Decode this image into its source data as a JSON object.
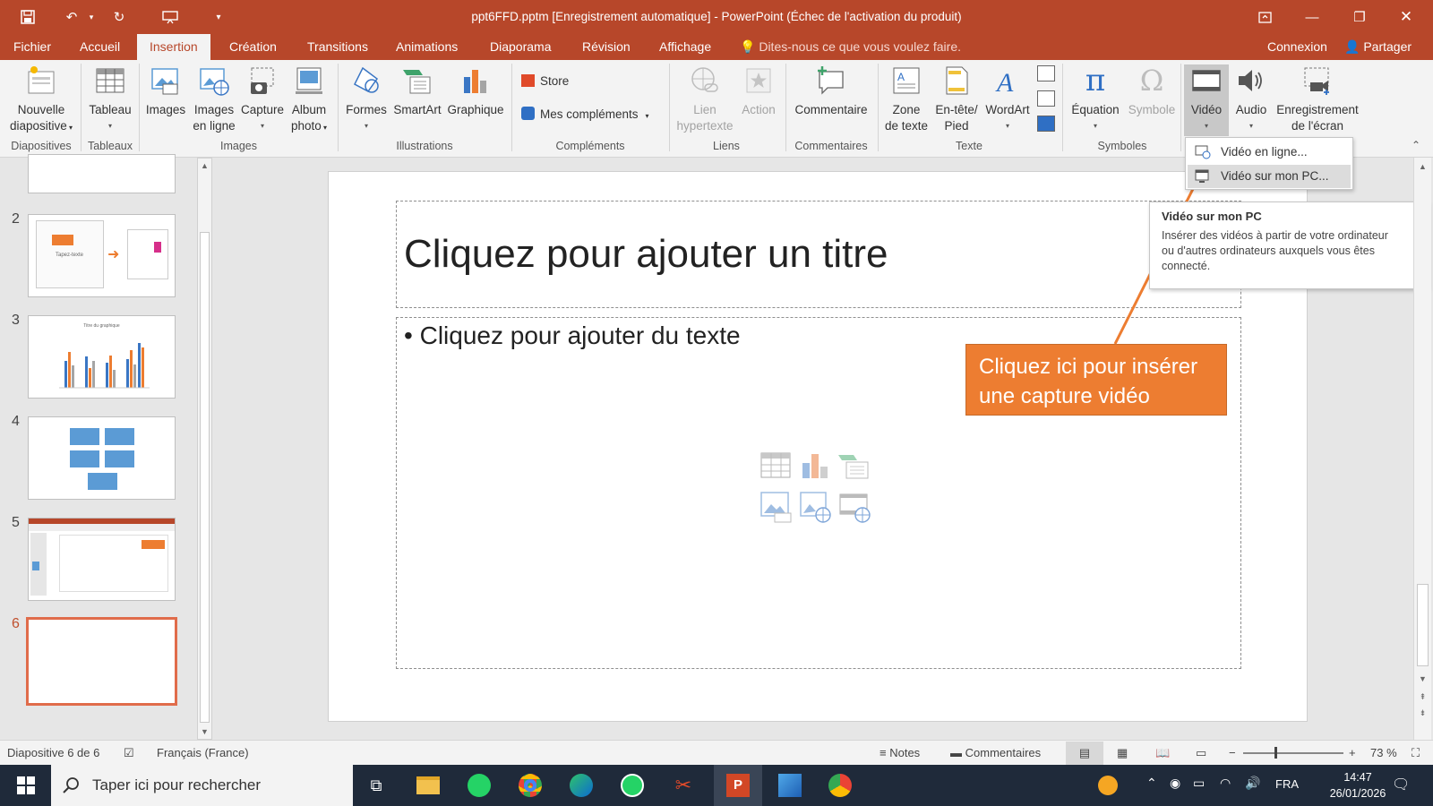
{
  "titlebar": {
    "title": "ppt6FFD.pptm [Enregistrement automatique]  -  PowerPoint (Échec de l'activation du produit)"
  },
  "menu": {
    "tabs": [
      "Fichier",
      "Accueil",
      "Insertion",
      "Création",
      "Transitions",
      "Animations",
      "Diaporama",
      "Révision",
      "Affichage"
    ],
    "active_tab": "Insertion",
    "tell_me": "Dites-nous ce que vous voulez faire.",
    "connexion": "Connexion",
    "partager": "Partager"
  },
  "ribbon": {
    "nouvelle_diapositive": [
      "Nouvelle",
      "diapositive"
    ],
    "tableau": "Tableau",
    "images": "Images",
    "images_en_ligne": [
      "Images",
      "en ligne"
    ],
    "capture": "Capture",
    "album_photo": [
      "Album",
      "photo"
    ],
    "formes": "Formes",
    "smartart": "SmartArt",
    "graphique": "Graphique",
    "store": "Store",
    "mes_complements": "Mes compléments",
    "lien_hypertexte": [
      "Lien",
      "hypertexte"
    ],
    "action": "Action",
    "commentaire": "Commentaire",
    "zone_de_texte": [
      "Zone",
      "de texte"
    ],
    "en_tete_pied": [
      "En-tête/",
      "Pied"
    ],
    "wordart": "WordArt",
    "equation": "Équation",
    "symbole": "Symbole",
    "video": "Vidéo",
    "audio": "Audio",
    "enregistrement_ecran": [
      "Enregistrement",
      "de l'écran"
    ],
    "groups": {
      "diapositives": "Diapositives",
      "tableaux": "Tableaux",
      "images": "Images",
      "illustrations": "Illustrations",
      "complements": "Compléments",
      "liens": "Liens",
      "commentaires": "Commentaires",
      "texte": "Texte",
      "symboles": "Symboles"
    }
  },
  "dropdown": {
    "items": [
      "Vidéo en ligne...",
      "Vidéo sur mon PC..."
    ]
  },
  "tooltip": {
    "title": "Vidéo sur mon PC",
    "lines": [
      "Insérer des vidéos à partir de votre ordinateur",
      "ou d'autres ordinateurs auxquels vous êtes",
      "connecté."
    ]
  },
  "thumbnails": {
    "numbers": [
      "2",
      "3",
      "4",
      "5",
      "6"
    ],
    "thumb2_caption": "Tapez-texte",
    "thumb3_caption": "Titre du graphique"
  },
  "slide": {
    "title_placeholder": "Cliquez pour ajouter un titre",
    "content_placeholder": "Cliquez pour ajouter du texte"
  },
  "callout": {
    "lines": [
      "Cliquez ici pour insérer",
      "une capture vidéo"
    ]
  },
  "status": {
    "slide_info": "Diapositive 6 de 6",
    "language": "Français (France)",
    "notes": "Notes",
    "comments": "Commentaires",
    "zoom": "73 %"
  },
  "taskbar": {
    "search_placeholder": "Taper ici pour rechercher",
    "language": "FRA",
    "time": "14:47",
    "date": "26/01/2026"
  },
  "colors": {
    "accent": "#b7472a",
    "callout": "#ed7d31",
    "selected_thumb": "#e06c4b"
  }
}
